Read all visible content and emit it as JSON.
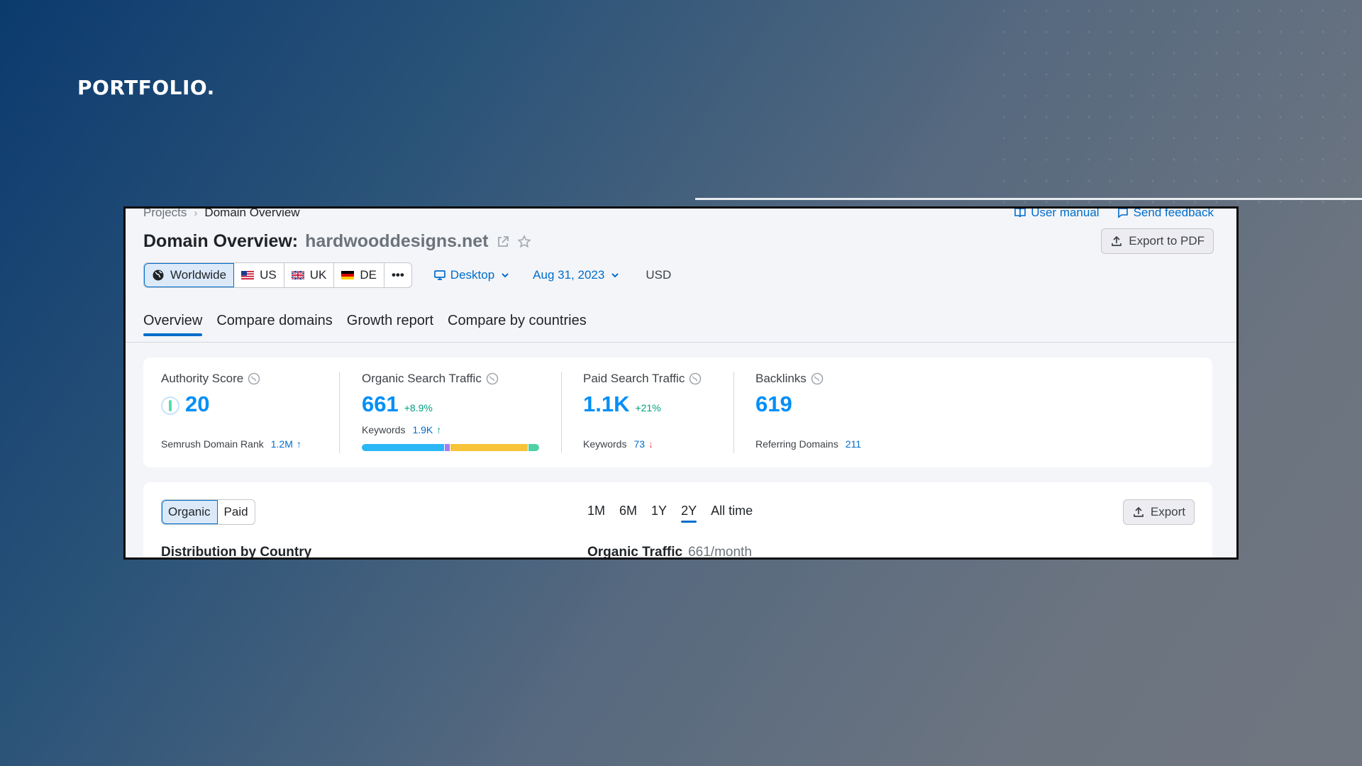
{
  "brand": {
    "logo_text": "PORTFOLIO."
  },
  "breadcrumb": {
    "items": [
      "Projects",
      "Domain Overview"
    ],
    "separator": "›"
  },
  "top_links": {
    "user_manual": "User manual",
    "send_feedback": "Send feedback"
  },
  "header": {
    "title": "Domain Overview:",
    "domain": "hardwooddesigns.net",
    "export_pdf": "Export to PDF"
  },
  "regions": {
    "worldwide": "Worldwide",
    "us": "US",
    "uk": "UK",
    "de": "DE",
    "more": "•••"
  },
  "device": {
    "label": "Desktop"
  },
  "date": {
    "label": "Aug 31, 2023"
  },
  "currency": "USD",
  "tabs": [
    "Overview",
    "Compare domains",
    "Growth report",
    "Compare by countries"
  ],
  "metrics": {
    "authority": {
      "label": "Authority Score",
      "value": "20",
      "sub_label": "Semrush Domain Rank",
      "sub_value": "1.2M",
      "sub_arrow": "↑"
    },
    "organic": {
      "label": "Organic Search Traffic",
      "value": "661",
      "delta": "+8.9%",
      "sub_label": "Keywords",
      "sub_value": "1.9K",
      "sub_arrow": "↑"
    },
    "paid": {
      "label": "Paid Search Traffic",
      "value": "1.1K",
      "delta": "+21%",
      "sub_label": "Keywords",
      "sub_value": "73",
      "sub_arrow": "↓"
    },
    "backlinks": {
      "label": "Backlinks",
      "value": "619",
      "sub_label": "Referring Domains",
      "sub_value": "211"
    }
  },
  "keyword_bar": [
    {
      "share": 0.47,
      "color": "#2bb7f6"
    },
    {
      "share": 0.03,
      "color": "#a57cf5"
    },
    {
      "share": 0.44,
      "color": "#f7c338"
    },
    {
      "share": 0.06,
      "color": "#4ed1a4"
    }
  ],
  "traffic_card": {
    "toggle": [
      "Organic",
      "Paid"
    ],
    "periods": [
      "1M",
      "6M",
      "1Y",
      "2Y",
      "All time"
    ],
    "active_period": "2Y",
    "export": "Export",
    "left_title": "Distribution by Country",
    "right_title": "Organic Traffic",
    "right_sub": "661/month"
  },
  "colors": {
    "accent": "#006dca",
    "metric_value": "#008ff8",
    "positive": "#009f81",
    "negative": "#ff4953"
  }
}
